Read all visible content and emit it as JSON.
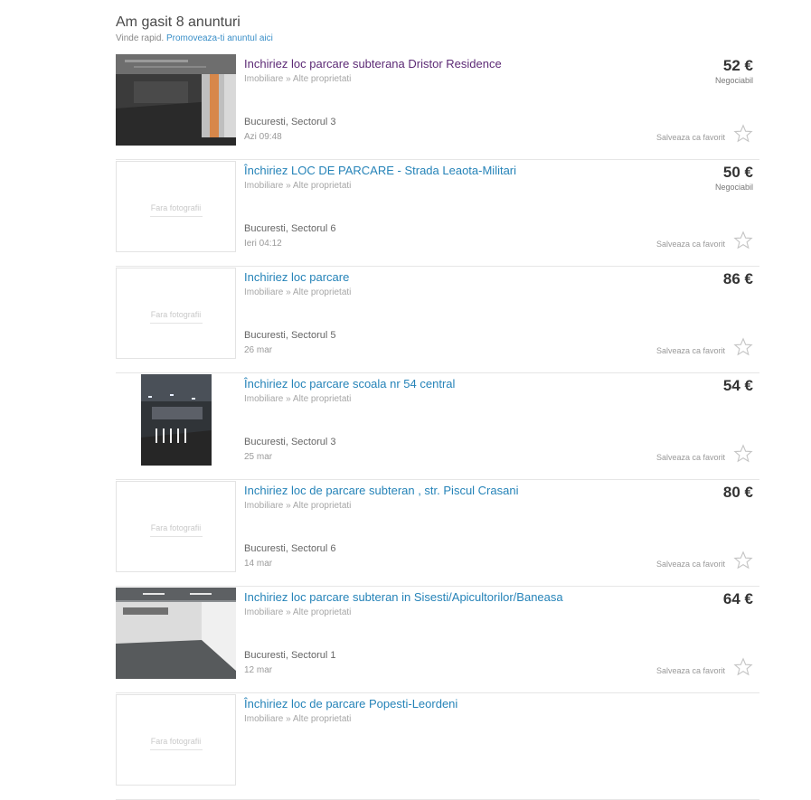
{
  "results": {
    "title": "Am gasit 8 anunturi",
    "promo_prefix": "Vinde rapid.",
    "promo_link": "Promoveaza-ti anuntul aici"
  },
  "labels": {
    "no_photo": "Fara fotografii",
    "save_favorite": "Salveaza ca favorit"
  },
  "listings": [
    {
      "title": "Inchiriez loc parcare subterana Dristor Residence",
      "category": "Imobiliare » Alte proprietati",
      "location": "Bucuresti, Sectorul 3",
      "date": "Azi 09:48",
      "price": "52 €",
      "negotiable": "Negociabil",
      "photo": "garage-dark",
      "visited": true
    },
    {
      "title": "Închiriez LOC DE PARCARE - Strada Leaota-Militari",
      "category": "Imobiliare » Alte proprietati",
      "location": "Bucuresti, Sectorul 6",
      "date": "Ieri 04:12",
      "price": "50 €",
      "negotiable": "Negociabil",
      "photo": "none",
      "visited": false
    },
    {
      "title": "Inchiriez loc parcare",
      "category": "Imobiliare » Alte proprietati",
      "location": "Bucuresti, Sectorul 5",
      "date": "26 mar",
      "price": "86 €",
      "negotiable": "",
      "photo": "none",
      "visited": false
    },
    {
      "title": "Închiriez loc parcare scoala nr 54 central",
      "category": "Imobiliare » Alte proprietati",
      "location": "Bucuresti, Sectorul 3",
      "date": "25 mar",
      "price": "54 €",
      "negotiable": "",
      "photo": "garage-lit",
      "visited": false
    },
    {
      "title": "Inchiriez loc de parcare subteran , str. Piscul Crasani",
      "category": "Imobiliare » Alte proprietati",
      "location": "Bucuresti, Sectorul 6",
      "date": "14 mar",
      "price": "80 €",
      "negotiable": "",
      "photo": "none",
      "visited": false
    },
    {
      "title": "Inchiriez loc parcare subteran in Sisesti/Apicultorilor/Baneasa",
      "category": "Imobiliare » Alte proprietati",
      "location": "Bucuresti, Sectorul 1",
      "date": "12 mar",
      "price": "64 €",
      "negotiable": "",
      "photo": "garage-white",
      "visited": false
    },
    {
      "title": "Închiriez loc de parcare Popesti-Leordeni",
      "category": "Imobiliare » Alte proprietati",
      "location": "",
      "date": "",
      "price": "",
      "negotiable": "",
      "photo": "none",
      "visited": false
    }
  ],
  "colors": {
    "link": "#2583b8",
    "visited_link": "#5c2a75",
    "promo_link": "#3a8fc8"
  }
}
